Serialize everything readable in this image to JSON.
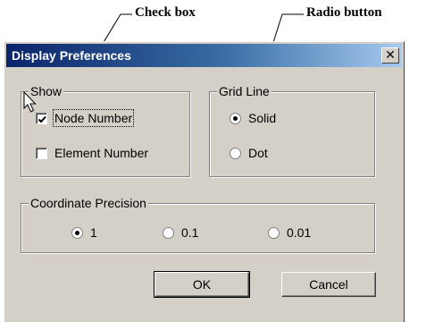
{
  "annotations": {
    "checkbox_label": "Check box",
    "radio_label": "Radio button"
  },
  "dialog": {
    "title": "Display Preferences",
    "close_glyph": "✕",
    "show_group": {
      "legend": "Show",
      "node_number": {
        "label": "Node Number",
        "checked": true
      },
      "element_number": {
        "label": "Element Number",
        "checked": false
      }
    },
    "grid_group": {
      "legend": "Grid Line",
      "solid": {
        "label": "Solid",
        "selected": true
      },
      "dot": {
        "label": "Dot",
        "selected": false
      }
    },
    "precision_group": {
      "legend": "Coordinate Precision",
      "options": [
        {
          "label": "1",
          "selected": true
        },
        {
          "label": "0.1",
          "selected": false
        },
        {
          "label": "0.01",
          "selected": false
        }
      ]
    },
    "ok_label": "OK",
    "cancel_label": "Cancel"
  },
  "icons": {
    "close": "close-icon",
    "cursor": "mouse-pointer-icon",
    "checkmark": "checkmark-icon"
  }
}
